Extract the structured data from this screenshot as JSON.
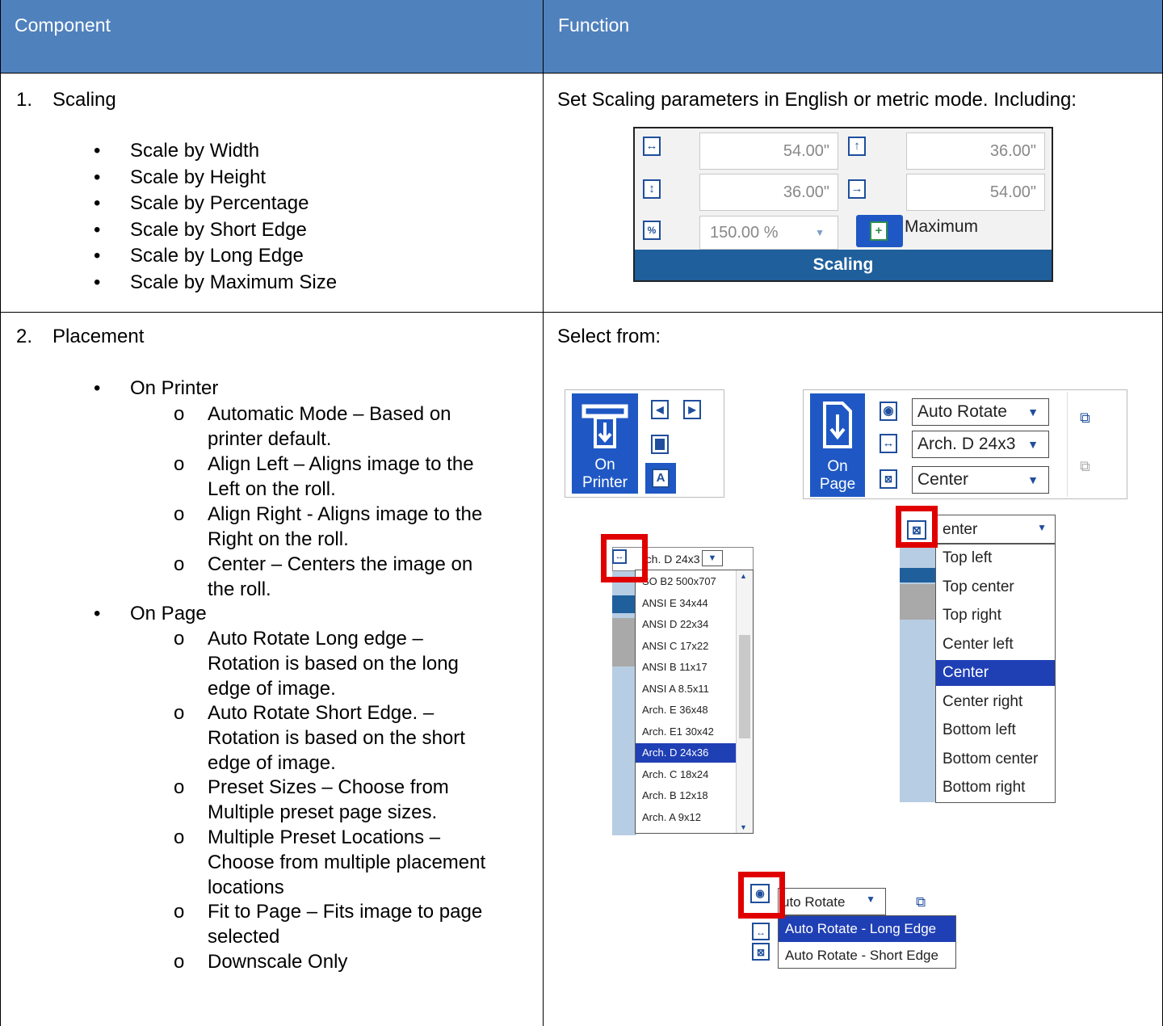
{
  "table": {
    "header": {
      "component": "Component",
      "function": "Function"
    },
    "rows": [
      {
        "number": "1.",
        "component": "Scaling",
        "bullets": [
          "Scale by Width",
          "Scale by Height",
          "Scale by Percentage",
          "Scale by Short Edge",
          "Scale by Long Edge",
          "Scale by Maximum Size"
        ],
        "function_text": "Set Scaling parameters in English or metric mode. Including:"
      },
      {
        "number": "2.",
        "component": "Placement",
        "groups": [
          {
            "label": "On Printer",
            "items": [
              [
                "Automatic Mode – Based on",
                "printer default."
              ],
              [
                "Align Left – Aligns image to the",
                "Left on the roll."
              ],
              [
                "Align Right - Aligns image to the",
                "Right on the roll."
              ],
              [
                "Center – Centers the image on",
                "the roll."
              ]
            ]
          },
          {
            "label": "On Page",
            "items": [
              [
                "Auto Rotate Long edge –",
                "Rotation is based on the long",
                "edge of image."
              ],
              [
                "Auto Rotate Short Edge. –",
                "Rotation is based on the short",
                "edge of image."
              ],
              [
                "Preset Sizes – Choose from",
                "Multiple preset page sizes."
              ],
              [
                "Multiple Preset Locations –",
                "Choose from multiple placement",
                "locations"
              ],
              [
                "Fit to Page – Fits image to page",
                "selected"
              ],
              [
                "Downscale Only"
              ]
            ]
          }
        ],
        "function_text": "Select from:"
      }
    ]
  },
  "scaling_panel": {
    "width_value": "54.00\"",
    "height_value": "36.00\"",
    "short_edge_value": "36.00\"",
    "long_edge_value": "54.00\"",
    "percent_value": "150.00 %",
    "maximum_label": "Maximum",
    "footer": "Scaling",
    "footer_color": "#1f5f9c"
  },
  "on_printer_panel": {
    "label_line1": "On",
    "label_line2": "Printer",
    "align_auto_glyph": "A"
  },
  "on_page_panel": {
    "label_line1": "On",
    "label_line2": "Page",
    "rotate_value": "Auto Rotate",
    "size_value": "Arch. D 24x3",
    "location_value": "Center"
  },
  "size_dropdown": {
    "value": "rch. D 24x3",
    "options": [
      "SO B2 500x707",
      "ANSI E 34x44",
      "ANSI D 22x34",
      "ANSI C 17x22",
      "ANSI B 11x17",
      "ANSI A 8.5x11",
      "Arch. E 36x48",
      "Arch. E1 30x42",
      "Arch. D 24x36",
      "Arch. C 18x24",
      "Arch. B 12x18",
      "Arch. A 9x12"
    ],
    "selected": "Arch. D 24x36"
  },
  "location_dropdown": {
    "value": "enter",
    "options": [
      "Top left",
      "Top center",
      "Top right",
      "Center left",
      "Center",
      "Center right",
      "Bottom left",
      "Bottom center",
      "Bottom right"
    ],
    "selected": "Center"
  },
  "rotate_dropdown": {
    "value": "uto Rotate",
    "options": [
      "Auto Rotate - Long Edge",
      "Auto Rotate - Short Edge"
    ],
    "selected": "Auto Rotate - Long Edge"
  },
  "colors": {
    "header_bg": "#4f81bd",
    "selection": "#1f3fb5",
    "highlight_box": "#e00000",
    "ribbon_blue": "#1f58c4"
  }
}
